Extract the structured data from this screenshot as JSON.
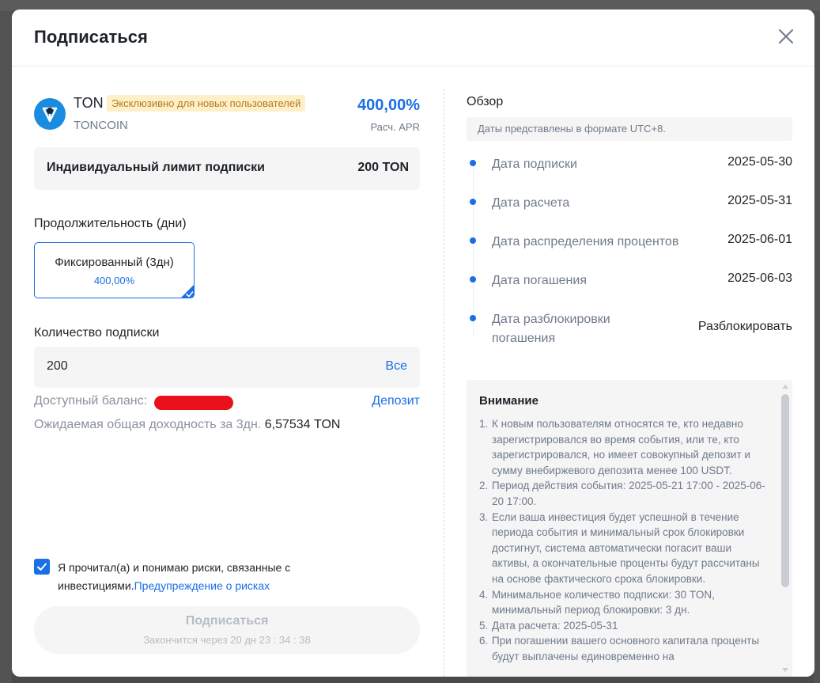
{
  "modal": {
    "title": "Подписаться"
  },
  "product": {
    "coin": "TON",
    "coin_full": "TONCOIN",
    "badge": "Эксклюзивно для новых пользователей",
    "apr_value": "400,00%",
    "apr_label": "Расч. APR"
  },
  "limit": {
    "label": "Индивидуальный лимит подписки",
    "value": "200 TON"
  },
  "duration": {
    "label": "Продолжительность (дни)",
    "option_name": "Фиксированный (3дн)",
    "option_rate": "400,00%"
  },
  "amount": {
    "label": "Количество подписки",
    "value": "200",
    "max_label": "Все"
  },
  "balance": {
    "label": "Доступный баланс:",
    "deposit_label": "Депозит"
  },
  "expected": {
    "label": "Ожидаемая общая доходность за 3дн.",
    "value": "6,57534 TON"
  },
  "agreement": {
    "text": "Я прочитал(а) и понимаю риски, связанные с инвестициями.",
    "link": "Предупреждение о рисках",
    "checked": true
  },
  "subscribe": {
    "label": "Подписаться",
    "timer": "Закончится через 20 дн 23 : 34 : 38"
  },
  "overview": {
    "title": "Обзор",
    "tz_note": "Даты представлены в формате UTC+8.",
    "timeline": [
      {
        "label": "Дата подписки",
        "value": "2025-05-30"
      },
      {
        "label": "Дата расчета",
        "value": "2025-05-31"
      },
      {
        "label": "Дата распределения процентов",
        "value": "2025-06-01"
      },
      {
        "label": "Дата погашения",
        "value": "2025-06-03"
      },
      {
        "label": "Дата разблокировки погашения",
        "value": "Разблокировать"
      }
    ]
  },
  "attention": {
    "title": "Внимание",
    "items": [
      {
        "num": "1.",
        "text": "К новым пользователям относятся те, кто недавно зарегистрировался во время события, или те, кто зарегистрировался, но имеет совокупный депозит и сумму внебиржевого депозита менее 100 USDT."
      },
      {
        "num": "2.",
        "text": "Период действия события: 2025-05-21 17:00 - 2025-06-20 17:00."
      },
      {
        "num": "3.",
        "text": "Если ваша инвестиция будет успешной в течение периода события и минимальный срок блокировки достигнут, система автоматически погасит ваши активы, а окончательные проценты будут рассчитаны на основе фактического срока блокировки."
      },
      {
        "num": "4.",
        "text": "Минимальное количество подписки: 30 TON, минимальный период блокировки: 3 дн."
      },
      {
        "num": "5.",
        "text": "Дата расчета: 2025-05-31"
      },
      {
        "num": "6.",
        "text": "При погашении вашего основного капитала проценты будут выплачены единовременно на"
      }
    ]
  },
  "colors": {
    "accent": "#1a6ee6",
    "badge_bg": "#fdf0c9",
    "badge_text": "#b7791f"
  },
  "icons": {
    "close": "close-icon",
    "coin": "toncoin-logo-icon",
    "check": "checkmark-icon"
  }
}
